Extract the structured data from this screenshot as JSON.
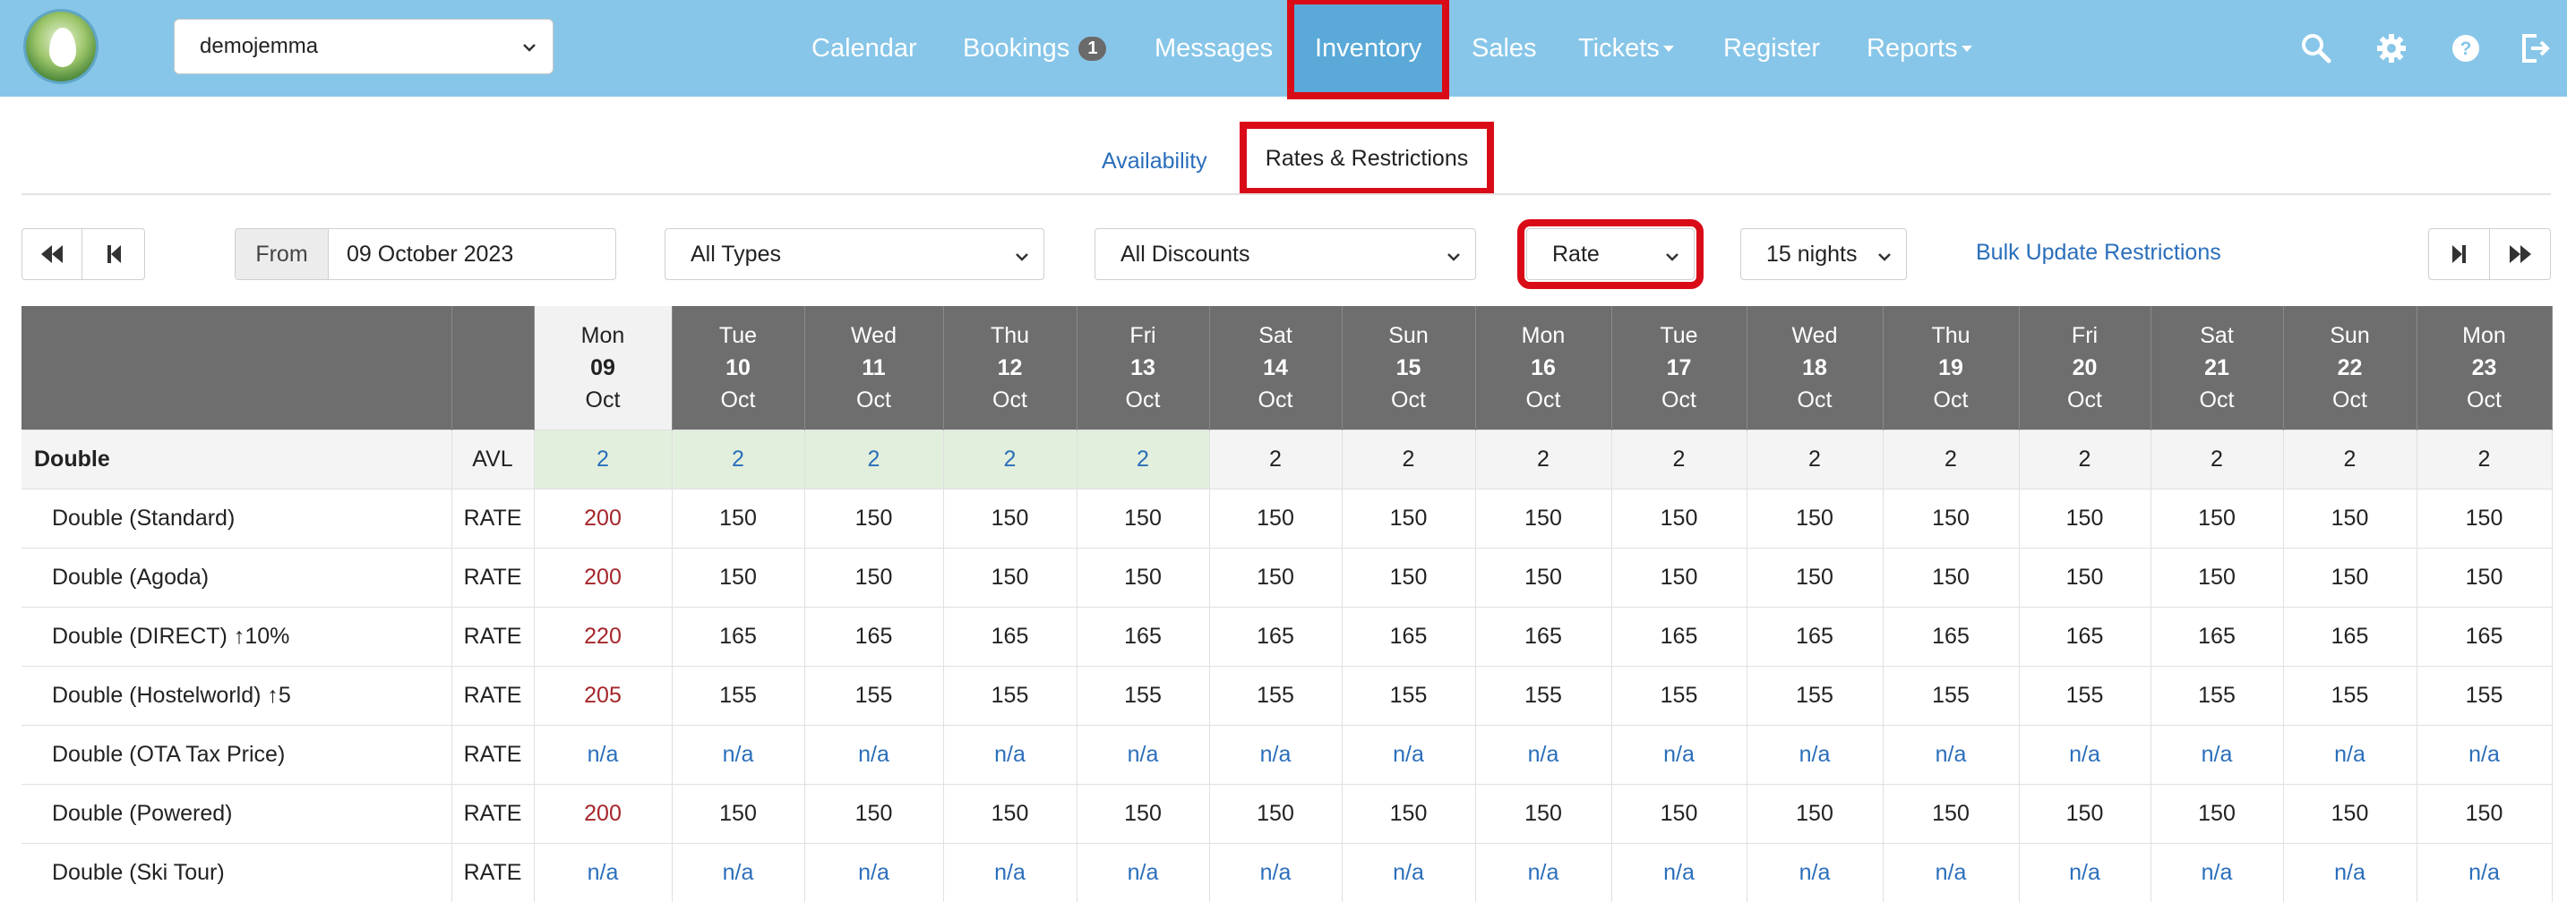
{
  "nav": {
    "property": "demojemma",
    "items": [
      {
        "label": "Calendar"
      },
      {
        "label": "Bookings",
        "badge": "1"
      },
      {
        "label": "Messages"
      },
      {
        "label": "Inventory",
        "active": true
      },
      {
        "label": "Sales"
      },
      {
        "label": "Tickets",
        "dropdown": true
      },
      {
        "label": "Register"
      },
      {
        "label": "Reports",
        "dropdown": true
      }
    ],
    "icons": [
      "search-icon",
      "gear-icon",
      "help-icon",
      "logout-icon"
    ]
  },
  "subtabs": {
    "availability": "Availability",
    "rates": "Rates & Restrictions"
  },
  "toolbar": {
    "from_label": "From",
    "from_value": "09 October 2023",
    "types": "All Types",
    "discounts": "All Discounts",
    "view": "Rate",
    "nights": "15 nights",
    "bulk": "Bulk Update Restrictions"
  },
  "table": {
    "dates": [
      {
        "dow": "Mon",
        "day": "09",
        "mon": "Oct"
      },
      {
        "dow": "Tue",
        "day": "10",
        "mon": "Oct"
      },
      {
        "dow": "Wed",
        "day": "11",
        "mon": "Oct"
      },
      {
        "dow": "Thu",
        "day": "12",
        "mon": "Oct"
      },
      {
        "dow": "Fri",
        "day": "13",
        "mon": "Oct"
      },
      {
        "dow": "Sat",
        "day": "14",
        "mon": "Oct"
      },
      {
        "dow": "Sun",
        "day": "15",
        "mon": "Oct"
      },
      {
        "dow": "Mon",
        "day": "16",
        "mon": "Oct"
      },
      {
        "dow": "Tue",
        "day": "17",
        "mon": "Oct"
      },
      {
        "dow": "Wed",
        "day": "18",
        "mon": "Oct"
      },
      {
        "dow": "Thu",
        "day": "19",
        "mon": "Oct"
      },
      {
        "dow": "Fri",
        "day": "20",
        "mon": "Oct"
      },
      {
        "dow": "Sat",
        "day": "21",
        "mon": "Oct"
      },
      {
        "dow": "Sun",
        "day": "22",
        "mon": "Oct"
      },
      {
        "dow": "Mon",
        "day": "23",
        "mon": "Oct"
      }
    ],
    "room": {
      "name": "Double",
      "type": "AVL",
      "values": [
        "2",
        "2",
        "2",
        "2",
        "2",
        "2",
        "2",
        "2",
        "2",
        "2",
        "2",
        "2",
        "2",
        "2",
        "2"
      ],
      "green_count": 5
    },
    "rows": [
      {
        "name": "Double (Standard)",
        "type": "RATE",
        "values": [
          "200",
          "150",
          "150",
          "150",
          "150",
          "150",
          "150",
          "150",
          "150",
          "150",
          "150",
          "150",
          "150",
          "150",
          "150"
        ]
      },
      {
        "name": "Double (Agoda)",
        "type": "RATE",
        "values": [
          "200",
          "150",
          "150",
          "150",
          "150",
          "150",
          "150",
          "150",
          "150",
          "150",
          "150",
          "150",
          "150",
          "150",
          "150"
        ]
      },
      {
        "name": "Double (DIRECT) ↑10%",
        "type": "RATE",
        "values": [
          "220",
          "165",
          "165",
          "165",
          "165",
          "165",
          "165",
          "165",
          "165",
          "165",
          "165",
          "165",
          "165",
          "165",
          "165"
        ]
      },
      {
        "name": "Double (Hostelworld) ↑5",
        "type": "RATE",
        "values": [
          "205",
          "155",
          "155",
          "155",
          "155",
          "155",
          "155",
          "155",
          "155",
          "155",
          "155",
          "155",
          "155",
          "155",
          "155"
        ]
      },
      {
        "name": "Double (OTA Tax Price)",
        "type": "RATE",
        "values": [
          "n/a",
          "n/a",
          "n/a",
          "n/a",
          "n/a",
          "n/a",
          "n/a",
          "n/a",
          "n/a",
          "n/a",
          "n/a",
          "n/a",
          "n/a",
          "n/a",
          "n/a"
        ]
      },
      {
        "name": "Double (Powered)",
        "type": "RATE",
        "values": [
          "200",
          "150",
          "150",
          "150",
          "150",
          "150",
          "150",
          "150",
          "150",
          "150",
          "150",
          "150",
          "150",
          "150",
          "150"
        ]
      },
      {
        "name": "Double (Ski Tour)",
        "type": "RATE",
        "values": [
          "n/a",
          "n/a",
          "n/a",
          "n/a",
          "n/a",
          "n/a",
          "n/a",
          "n/a",
          "n/a",
          "n/a",
          "n/a",
          "n/a",
          "n/a",
          "n/a",
          "n/a"
        ]
      }
    ]
  }
}
